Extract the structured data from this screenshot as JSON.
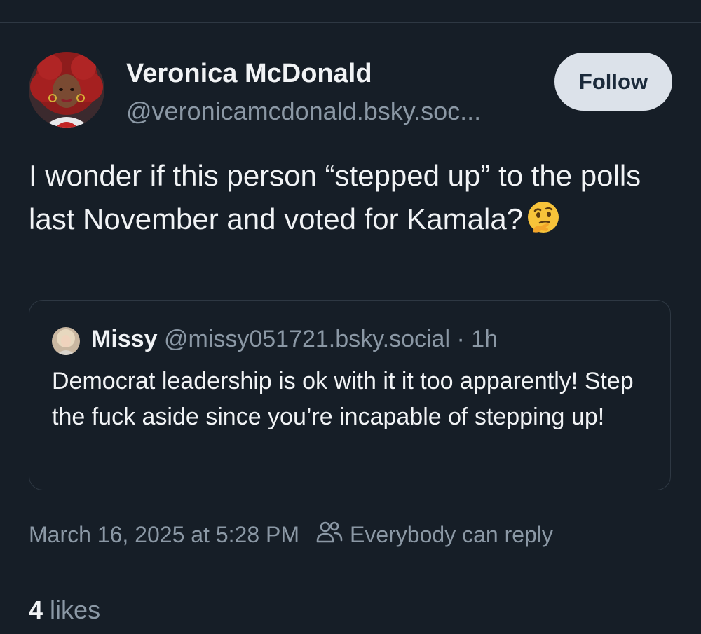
{
  "post": {
    "author": {
      "display_name": "Veronica McDonald",
      "handle": "@veronicamcdonald.bsky.soc..."
    },
    "follow_label": "Follow",
    "text": "I wonder if this person “stepped up” to the polls last November and voted for Kamala?",
    "emoji": "thinking-face-emoji",
    "quote": {
      "author_name": "Missy",
      "author_handle": "@missy051721.bsky.social",
      "separator": "·",
      "time": "1h",
      "text": "Democrat leadership is ok with it it too apparently! Step the fuck aside since you’re incapable of stepping up!"
    },
    "timestamp": "March 16, 2025 at 5:28 PM",
    "reply_setting": "Everybody can reply",
    "likes_count": "4",
    "likes_label": "likes"
  },
  "colors": {
    "background": "#161e27",
    "text_primary": "#f1f3f5",
    "text_secondary": "#8b98a5",
    "divider": "#2e3843",
    "follow_button_bg": "#dce2ea",
    "follow_button_text": "#1b2a3b"
  },
  "icons": {
    "reply_setting_icon": "people-icon"
  }
}
